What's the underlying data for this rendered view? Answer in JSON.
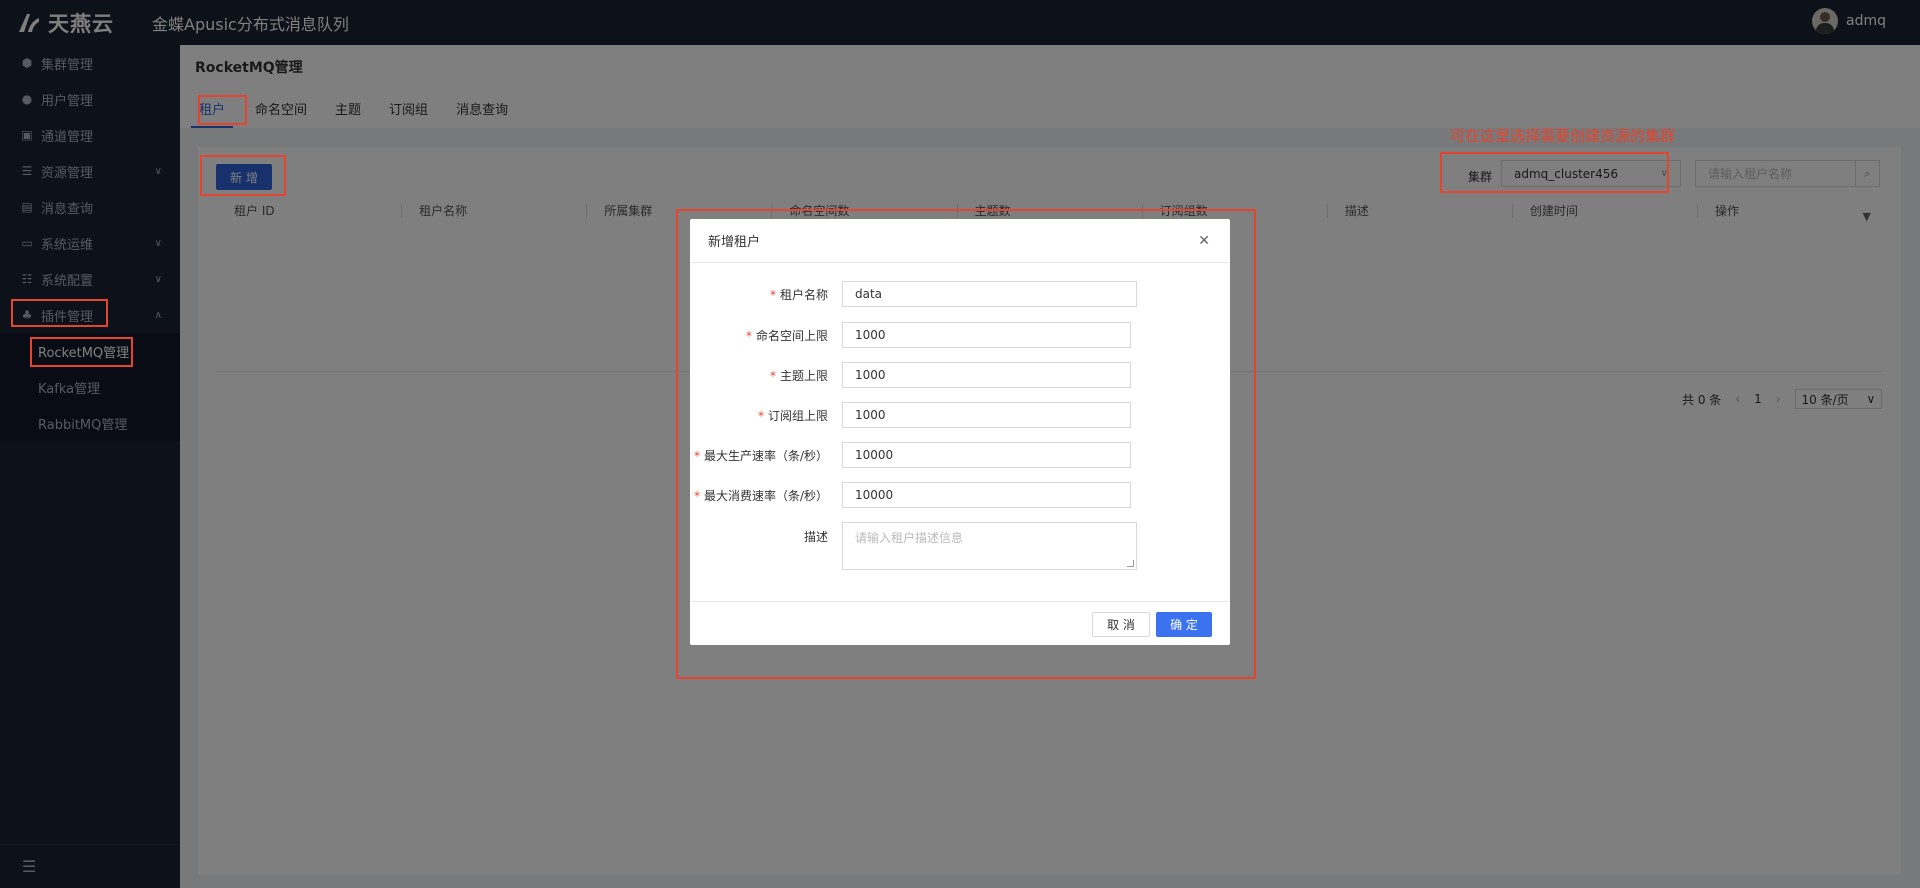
{
  "header": {
    "logo_text": "天燕云",
    "app_title": "金蝶Apusic分布式消息队列",
    "username": "admq"
  },
  "sidebar": {
    "items": [
      {
        "label": "集群管理",
        "icon": "cube-icon"
      },
      {
        "label": "用户管理",
        "icon": "user-icon"
      },
      {
        "label": "通道管理",
        "icon": "channel-icon"
      },
      {
        "label": "资源管理",
        "icon": "resource-icon",
        "expandable": true
      },
      {
        "label": "消息查询",
        "icon": "document-icon"
      },
      {
        "label": "系统运维",
        "icon": "ops-icon",
        "expandable": true
      },
      {
        "label": "系统配置",
        "icon": "config-icon",
        "expandable": true
      },
      {
        "label": "插件管理",
        "icon": "plugin-icon",
        "expanded": true
      }
    ],
    "submenu": [
      {
        "label": "RocketMQ管理",
        "active": true
      },
      {
        "label": "Kafka管理"
      },
      {
        "label": "RabbitMQ管理"
      }
    ]
  },
  "page": {
    "title": "RocketMQ管理",
    "tabs": [
      {
        "label": "租户",
        "active": true
      },
      {
        "label": "命名空间"
      },
      {
        "label": "主题"
      },
      {
        "label": "订阅组"
      },
      {
        "label": "消息查询"
      }
    ]
  },
  "toolbar": {
    "add_label": "新 增",
    "cluster_label": "集群",
    "cluster_value": "admq_cluster456",
    "search_placeholder": "请输入租户名称"
  },
  "annotation": {
    "text": "可在这里选择需要创建资源的集群",
    "color": "#e5452f"
  },
  "table": {
    "columns": [
      "租户 ID",
      "租户名称",
      "所属集群",
      "命名空间数",
      "主题数",
      "订阅组数",
      "描述",
      "创建时间",
      "操作"
    ]
  },
  "pagination": {
    "total": "共 0 条",
    "page": "1",
    "page_size": "10 条/页"
  },
  "dialog": {
    "title": "新增租户",
    "fields": [
      {
        "label": "租户名称",
        "required": true,
        "value": "data"
      },
      {
        "label": "命名空间上限",
        "required": true,
        "value": "1000"
      },
      {
        "label": "主题上限",
        "required": true,
        "value": "1000"
      },
      {
        "label": "订阅组上限",
        "required": true,
        "value": "1000"
      },
      {
        "label": "最大生产速率（条/秒）",
        "required": true,
        "value": "10000"
      },
      {
        "label": "最大消费速率（条/秒）",
        "required": true,
        "value": "10000"
      }
    ],
    "description": {
      "label": "描述",
      "placeholder": "请输入租户描述信息"
    },
    "cancel_label": "取 消",
    "ok_label": "确 定"
  },
  "colors": {
    "primary": "#2c62d8",
    "sidebar_bg": "#1b2233",
    "annotation": "#e5452f"
  }
}
